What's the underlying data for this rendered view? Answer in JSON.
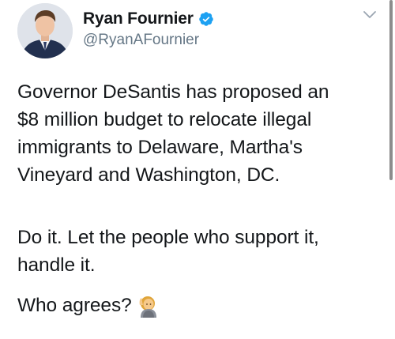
{
  "author": {
    "display_name": "Ryan Fournier",
    "handle": "@RyanAFournier",
    "verified": true,
    "verified_color": "#1da1f2"
  },
  "tweet": {
    "paragraphs": [
      "Governor DeSantis has proposed an\n$8 million budget to relocate illegal\nimmigrants to Delaware, Martha's\nVineyard and Washington, DC.",
      "Do it. Let the people who support it,\nhandle it.",
      "Who agrees?"
    ],
    "emoji": "raising-hand-emoji"
  },
  "icons": {
    "menu": "chevron-down-icon",
    "verified": "verified-badge-icon"
  },
  "colors": {
    "text": "#14171a",
    "secondary_text": "#657786",
    "accent": "#1da1f2"
  }
}
